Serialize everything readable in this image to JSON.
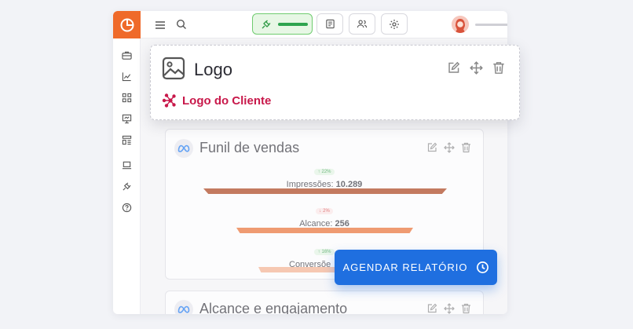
{
  "sidebar": {
    "items": [
      {
        "icon": "briefcase-icon"
      },
      {
        "icon": "chart-icon"
      },
      {
        "icon": "grid-icon"
      },
      {
        "icon": "presentation-icon"
      },
      {
        "icon": "layout-icon"
      },
      {
        "icon": "laptop-icon"
      },
      {
        "icon": "plug-icon"
      },
      {
        "icon": "help-icon"
      }
    ]
  },
  "colors": {
    "brand": "#ef6a2a",
    "client": "#c8184a",
    "primary_button": "#1f6fe0",
    "funnel_1": "#a8380f",
    "funnel_2": "#ec6b2a",
    "funnel_3": "#f6b08c"
  },
  "logo_widget": {
    "title": "Logo",
    "client_name": "Logo do Cliente"
  },
  "funnel_card": {
    "title": "Funil de vendas",
    "stages": [
      {
        "pct": "22%",
        "direction": "up",
        "label": "Impressões:",
        "value": "10.289"
      },
      {
        "pct": "2%",
        "direction": "down",
        "label": "Alcance:",
        "value": "256"
      },
      {
        "pct": "16%",
        "direction": "up",
        "label": "Conversõe",
        "value": ""
      }
    ]
  },
  "reach_card": {
    "title": "Alcance e engajamento"
  },
  "schedule_button": {
    "label": "AGENDAR RELATÓRIO"
  }
}
